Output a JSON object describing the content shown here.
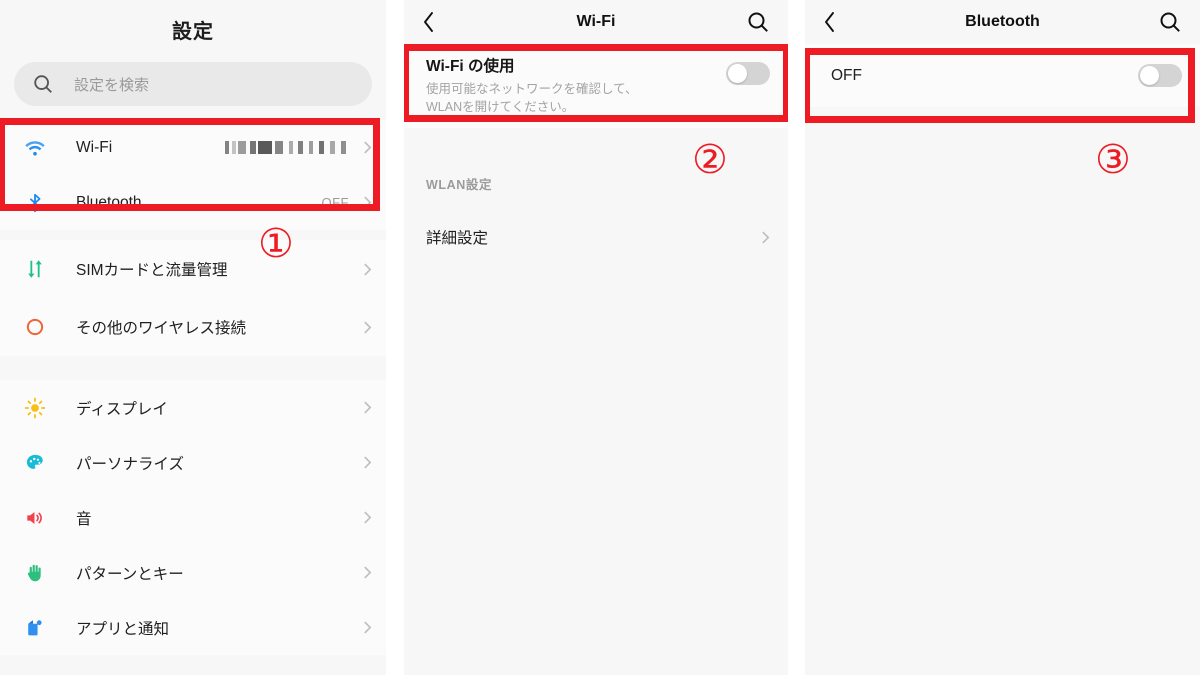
{
  "panels": {
    "settings": {
      "title": "設定",
      "search": {
        "placeholder": "設定を検索",
        "icon": "search-icon"
      },
      "group_network": [
        {
          "icon": "wifi-icon",
          "label": "Wi-Fi",
          "value": "",
          "value_masked": true,
          "chevron": "chevron-right-icon"
        },
        {
          "icon": "bluetooth-icon",
          "label": "Bluetooth",
          "value": "OFF",
          "value_masked": false,
          "chevron": "chevron-right-icon"
        }
      ],
      "group_connectivity": [
        {
          "icon": "sim-data-icon",
          "label": "SIMカードと流量管理",
          "value": "",
          "chevron": "chevron-right-icon"
        },
        {
          "icon": "wireless-more-icon",
          "label": "その他のワイヤレス接続",
          "value": "",
          "chevron": "chevron-right-icon"
        }
      ],
      "group_device": [
        {
          "icon": "brightness-icon",
          "label": "ディスプレイ",
          "value": "",
          "chevron": "chevron-right-icon"
        },
        {
          "icon": "palette-icon",
          "label": "パーソナライズ",
          "value": "",
          "chevron": "chevron-right-icon"
        },
        {
          "icon": "speaker-icon",
          "label": "音",
          "value": "",
          "chevron": "chevron-right-icon"
        },
        {
          "icon": "hand-icon",
          "label": "パターンとキー",
          "value": "",
          "chevron": "chevron-right-icon"
        },
        {
          "icon": "apps-icon",
          "label": "アプリと通知",
          "value": "",
          "chevron": "chevron-right-icon"
        }
      ]
    },
    "wifi": {
      "header": {
        "back": "back-arrow-icon",
        "title": "Wi-Fi",
        "search": "search-icon"
      },
      "toggle_card": {
        "title": "Wi-Fi の使用",
        "description_line1": "使用可能なネットワークを確認して、",
        "description_line2": "WLANを開けてください。",
        "toggle_state": "off"
      },
      "section_label": "WLAN設定",
      "rows": [
        {
          "label": "詳細設定",
          "chevron": "chevron-right-icon"
        }
      ]
    },
    "bluetooth": {
      "header": {
        "back": "back-arrow-icon",
        "title": "Bluetooth",
        "search": "search-icon"
      },
      "toggle_card": {
        "label": "OFF",
        "toggle_state": "off"
      }
    }
  },
  "annotations": {
    "marker_1": "①",
    "marker_2": "②",
    "marker_3": "③",
    "color": "#ed1c24"
  }
}
